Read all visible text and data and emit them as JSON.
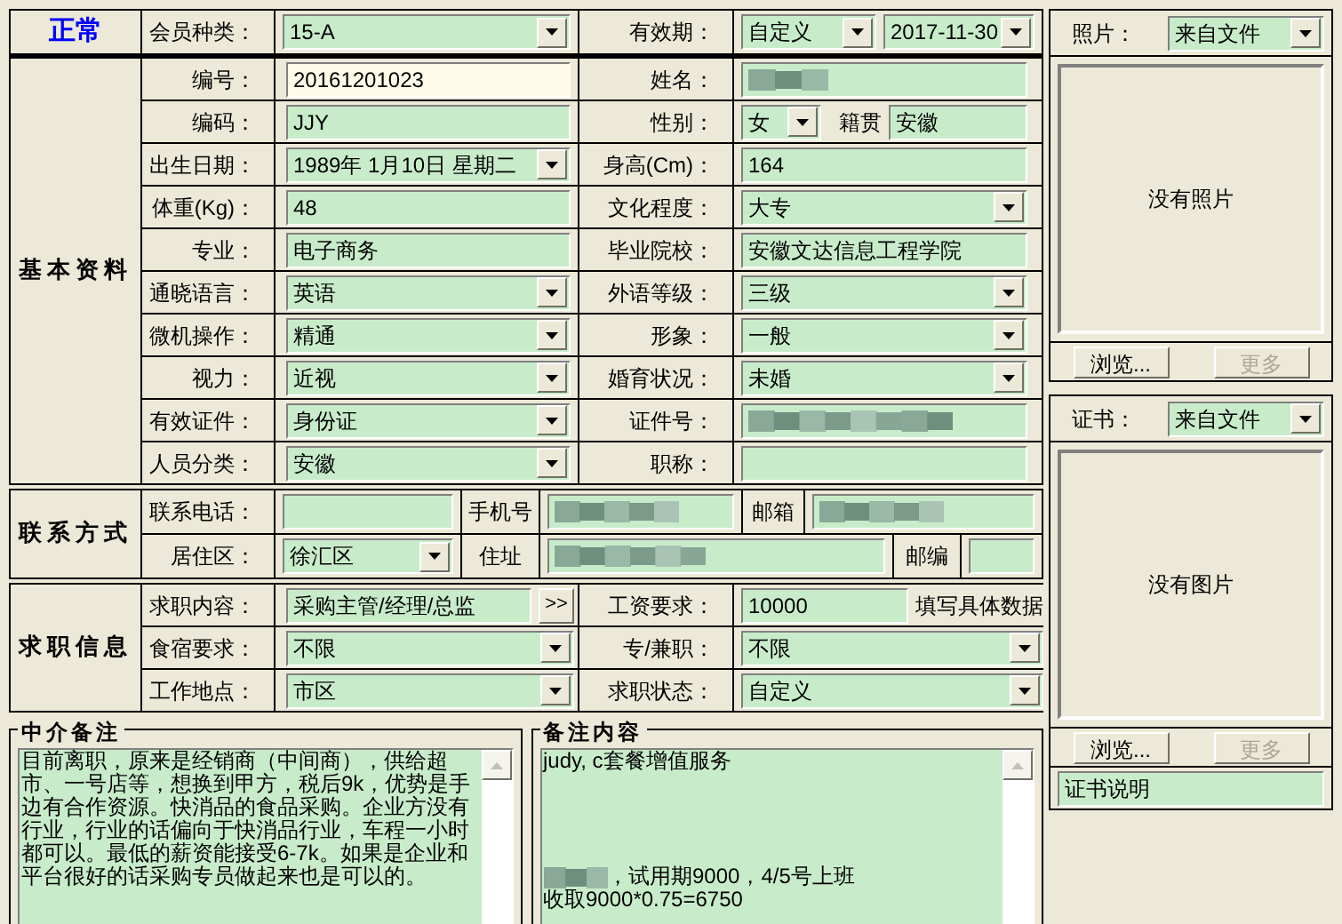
{
  "status": "正常",
  "member_type": {
    "label": "会员种类：",
    "kind": "dropdown",
    "value": "15-A"
  },
  "validity": {
    "label": "有效期：",
    "mode": {
      "kind": "dropdown",
      "value": "自定义"
    },
    "date": {
      "kind": "dropdown",
      "value": "2017-11-30"
    }
  },
  "basic_info": {
    "title": "基本资料",
    "rows": [
      [
        {
          "label": "编号：",
          "kind": "text",
          "value": "20161201023",
          "focused": true
        },
        {
          "label": "姓名：",
          "kind": "redacted",
          "focused": false
        }
      ],
      [
        {
          "label": "编码：",
          "kind": "text",
          "value": "JJY",
          "focused": false
        },
        {
          "label": "性别：",
          "kind": "pair",
          "value": "女",
          "extra_label": "籍贯",
          "extra_value": "安徽",
          "focused": false
        }
      ],
      [
        {
          "label": "出生日期：",
          "kind": "dropdown",
          "value": "1989年 1月10日 星期二",
          "focused": false
        },
        {
          "label": "身高(Cm)：",
          "kind": "text",
          "value": "164",
          "focused": false
        }
      ],
      [
        {
          "label": "体重(Kg)：",
          "kind": "text",
          "value": "48",
          "focused": false
        },
        {
          "label": "文化程度：",
          "kind": "dropdown",
          "value": "大专",
          "focused": false
        }
      ],
      [
        {
          "label": "专业：",
          "kind": "text",
          "value": "电子商务",
          "focused": false
        },
        {
          "label": "毕业院校：",
          "kind": "text",
          "value": "安徽文达信息工程学院",
          "focused": false
        }
      ],
      [
        {
          "label": "通晓语言：",
          "kind": "dropdown",
          "value": "英语",
          "focused": false
        },
        {
          "label": "外语等级：",
          "kind": "dropdown",
          "value": "三级",
          "focused": false
        }
      ],
      [
        {
          "label": "微机操作：",
          "kind": "dropdown",
          "value": "精通",
          "focused": false
        },
        {
          "label": "形象：",
          "kind": "dropdown",
          "value": "一般",
          "focused": false
        }
      ],
      [
        {
          "label": "视力：",
          "kind": "dropdown",
          "value": "近视",
          "focused": false
        },
        {
          "label": "婚育状况：",
          "kind": "dropdown",
          "value": "未婚",
          "focused": false
        }
      ],
      [
        {
          "label": "有效证件：",
          "kind": "dropdown",
          "value": "身份证",
          "focused": false
        },
        {
          "label": "证件号：",
          "kind": "redacted",
          "focused": false
        }
      ],
      [
        {
          "label": "人员分类：",
          "kind": "dropdown",
          "value": "安徽",
          "focused": false
        },
        {
          "label": "职称：",
          "kind": "text",
          "focused": false
        }
      ]
    ]
  },
  "contact": {
    "title": "联系方式",
    "rows": [
      [
        {
          "kind": "label",
          "text": "联系电话："
        },
        {
          "kind": "text"
        },
        {
          "kind": "label",
          "text": "手机号"
        },
        {
          "kind": "redacted"
        },
        {
          "kind": "label",
          "text": "邮箱"
        },
        {
          "kind": "redacted"
        }
      ],
      [
        {
          "kind": "label",
          "text": "居住区："
        },
        {
          "kind": "dropdown",
          "value": "徐汇区"
        },
        {
          "kind": "label",
          "text": "住址"
        },
        {
          "kind": "redacted"
        },
        {
          "kind": "label",
          "text": "邮编"
        },
        {
          "kind": "text"
        }
      ]
    ]
  },
  "job": {
    "title": "求职信息",
    "rows": [
      [
        {
          "label": "求职内容：",
          "kind": "text",
          "value": "采购主管/经理/总监",
          "button": ">>"
        },
        {
          "label": "工资要求：",
          "kind": "text",
          "value": "10000",
          "note": "填写具体数据"
        }
      ],
      [
        {
          "label": "食宿要求：",
          "kind": "dropdown",
          "value": "不限"
        },
        {
          "label": "专/兼职：",
          "kind": "dropdown",
          "value": "不限"
        }
      ],
      [
        {
          "label": "工作地点：",
          "kind": "dropdown",
          "value": "市区"
        },
        {
          "label": "求职状态：",
          "kind": "dropdown",
          "value": "自定义"
        }
      ]
    ]
  },
  "notes": [
    {
      "title": "中介备注",
      "lines": [
        {
          "kind": "text",
          "text": "目前离职，原来是经销商（中间商），供给超市、一号店等，想换到甲方，税后9k，优势是手边有合作资源。快消品的食品采购。企业方没有行业，行业的话偏向于快消品行业，车程一小时都可以。最低的薪资能接受6-7k。如果是企业和平台很好的话采购专员做起来也是可以的。"
        }
      ]
    },
    {
      "title": "备注内容",
      "lines": [
        {
          "kind": "text",
          "text": "judy, c套餐增值服务"
        },
        {
          "kind": "blank"
        },
        {
          "kind": "blank"
        },
        {
          "kind": "blank"
        },
        {
          "kind": "blank"
        },
        {
          "kind": "redacted_text",
          "text": "，试用期9000，4/5号上班"
        },
        {
          "kind": "text",
          "text": "收取9000*0.75=6750"
        }
      ]
    }
  ],
  "photo": {
    "label": "照片：",
    "source": {
      "kind": "dropdown",
      "value": "来自文件"
    },
    "empty_text": "没有照片",
    "buttons": [
      {
        "label": "浏览...",
        "disabled": false
      },
      {
        "label": "更多",
        "disabled": true
      }
    ]
  },
  "certificate": {
    "label": "证书：",
    "source": {
      "kind": "dropdown",
      "value": "来自文件"
    },
    "empty_text": "没有图片",
    "buttons": [
      {
        "label": "浏览...",
        "disabled": false
      },
      {
        "label": "更多",
        "disabled": true
      }
    ],
    "caption": {
      "kind": "text",
      "value": "证书说明"
    }
  }
}
